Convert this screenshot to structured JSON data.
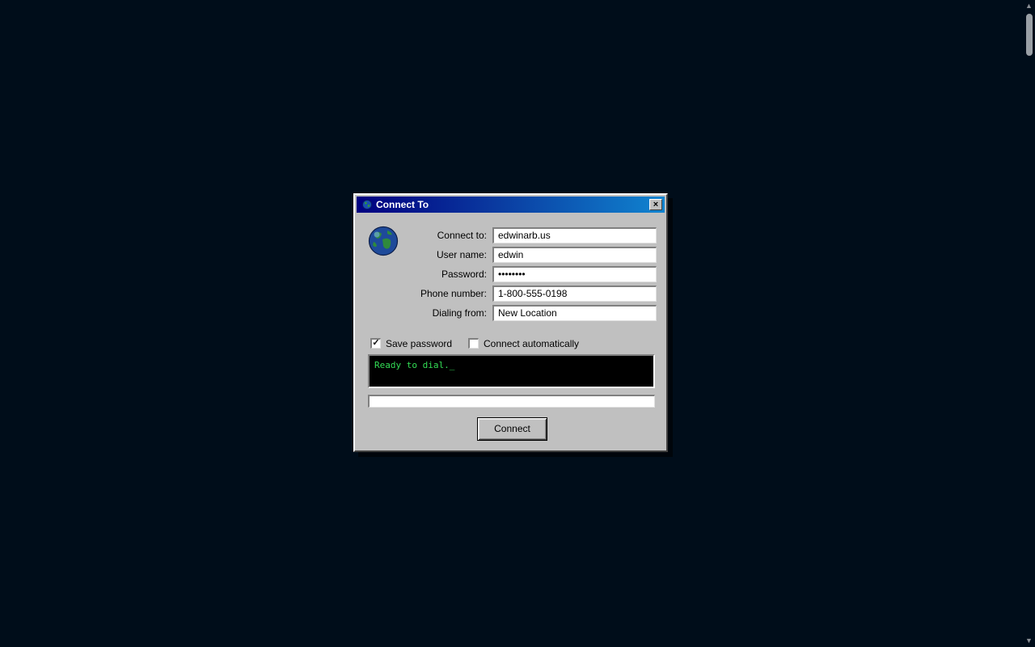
{
  "window": {
    "title": "Connect To",
    "close_label": "×"
  },
  "fields": [
    {
      "label": "Connect to:",
      "value": "edwinarb.us"
    },
    {
      "label": "User name:",
      "value": "edwin"
    },
    {
      "label": "Password:",
      "value": "••••••••"
    },
    {
      "label": "Phone number:",
      "value": "1-800-555-0198"
    },
    {
      "label": "Dialing from:",
      "value": "New Location"
    }
  ],
  "options": {
    "save_password": {
      "label": "Save password",
      "checked": true,
      "mark": "✓"
    },
    "connect_automatically": {
      "label": "Connect automatically",
      "checked": false,
      "mark": ""
    }
  },
  "status": {
    "text": "Ready to dial._"
  },
  "progress": {
    "fraction": 0
  },
  "actions": {
    "connect_label": "Connect"
  },
  "scrollbar": {
    "up_glyph": "▲",
    "down_glyph": "▼"
  },
  "colors": {
    "desktop": "#000d1a",
    "titlebar_start": "#000080",
    "titlebar_end": "#1084d0",
    "window_face": "#c0c0c0",
    "terminal_text": "#33dd55"
  },
  "icons": {
    "title": "globe-icon",
    "dialog": "globe-icon"
  }
}
